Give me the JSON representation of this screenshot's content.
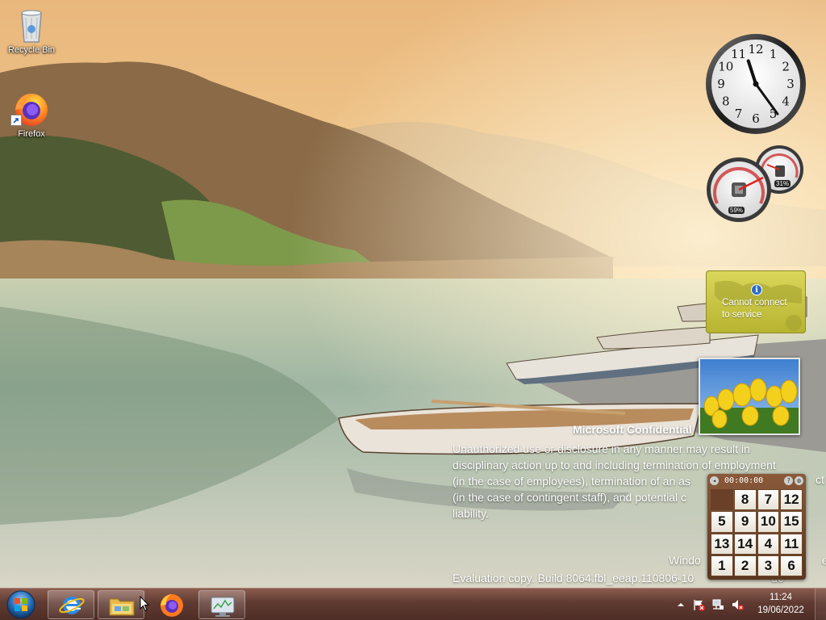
{
  "desktop": {
    "icons": [
      {
        "label": "Recycle Bin",
        "icon": "recycle-bin-icon"
      },
      {
        "label": "Firefox",
        "icon": "firefox-icon"
      }
    ]
  },
  "watermark": {
    "title": "Microsoft Confidential",
    "body": "Unauthorized use or disclosure in any manner may result in\ndisciplinary action up to and including termination of employment\n(in the case of employees), termination of an as\n(in the case of contingent staff), and potential c\nliability.",
    "body_right_fragments": [
      "ct"
    ],
    "os_line": "Windo",
    "os_line_right": "ew",
    "build_line": "Evaluation copy. Build 8064.fbl_eeap.110806-10",
    "build_line_right": "d0"
  },
  "gadgets": {
    "clock": {
      "hour": 11,
      "minute": 24
    },
    "cpu_meter": {
      "cpu_percent": "59%",
      "memory_percent": "31%"
    },
    "weather": {
      "message": "Cannot connect\nto service",
      "icon": "info-icon"
    },
    "slideshow": {
      "subject": "yellow tulips"
    },
    "puzzle": {
      "timer": "00:00:00",
      "tiles": [
        "",
        "8",
        "7",
        "12",
        "5",
        "9",
        "10",
        "15",
        "13",
        "14",
        "4",
        "11",
        "1",
        "2",
        "3",
        "6"
      ]
    }
  },
  "taskbar": {
    "start_icon": "windows-start-icon",
    "items": [
      {
        "name": "internet-explorer",
        "icon": "ie-icon"
      },
      {
        "name": "windows-explorer",
        "icon": "folder-icon"
      },
      {
        "name": "firefox",
        "icon": "firefox-icon"
      },
      {
        "name": "resource-monitor",
        "icon": "monitor-icon"
      }
    ],
    "tray": {
      "icons": [
        "show-hidden-icon",
        "action-center-flag-icon",
        "network-icon",
        "volume-muted-icon"
      ],
      "time": "11:24",
      "date": "19/06/2022"
    }
  },
  "colors": {
    "taskbar": "#5f3a31",
    "weather_gadget": "#c9c645",
    "puzzle_frame": "#7a4a2e"
  }
}
